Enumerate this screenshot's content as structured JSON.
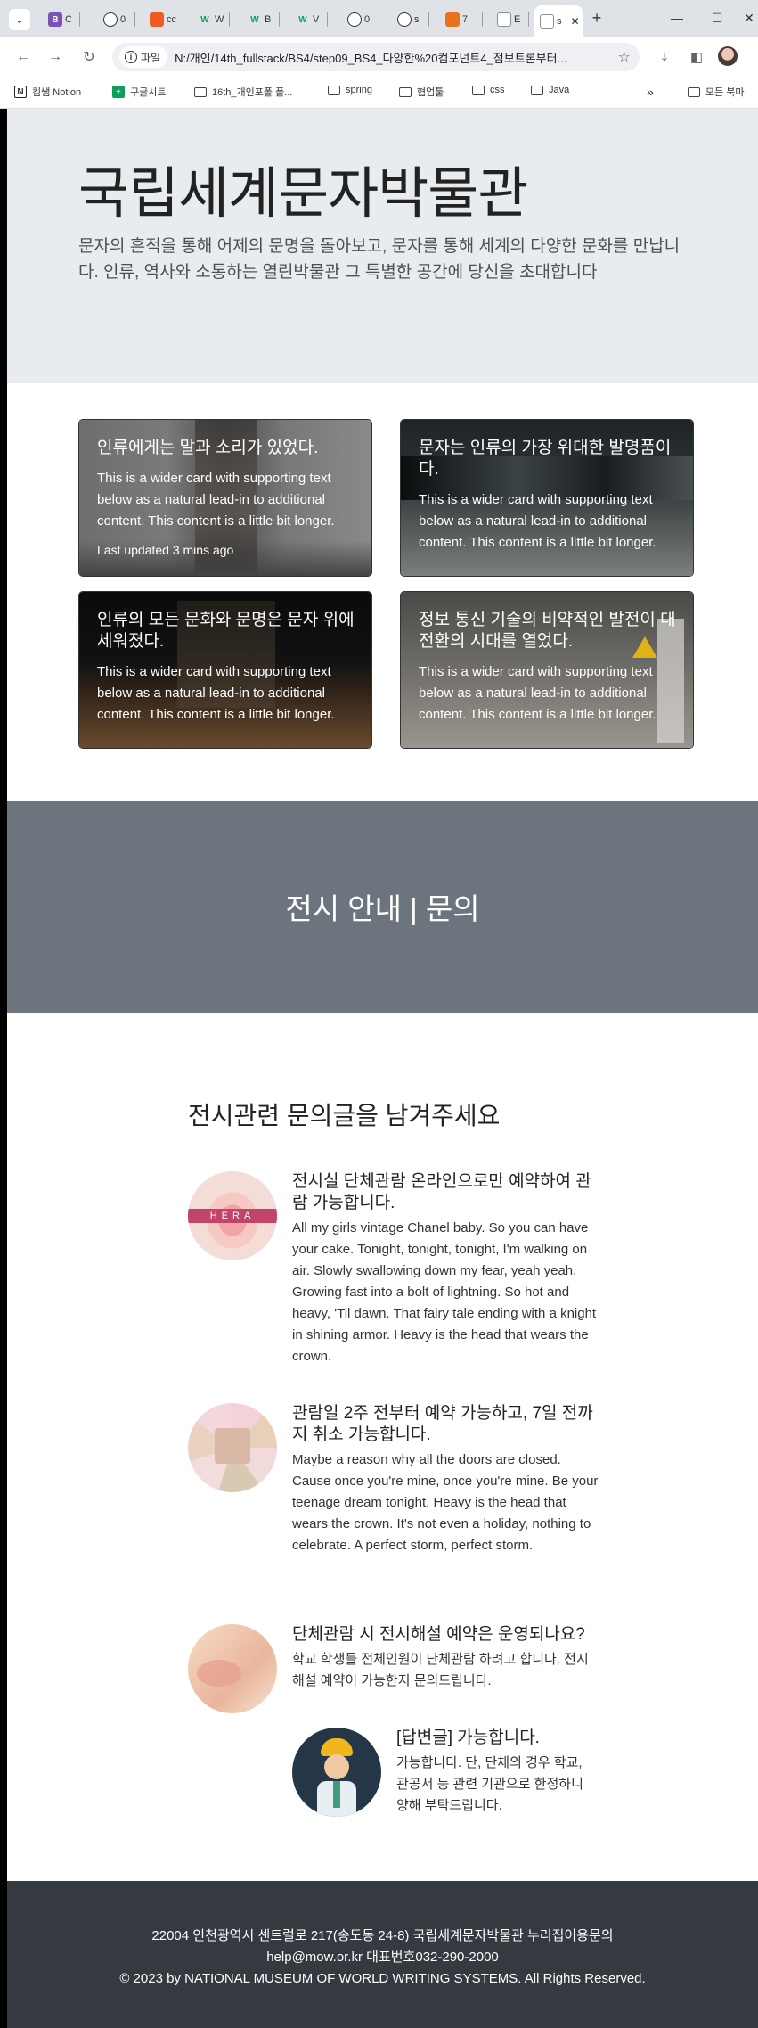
{
  "browser": {
    "tabs": [
      {
        "label": "C",
        "icon": "bootstrap-icon",
        "color": "#7952b3",
        "glyph": "B"
      },
      {
        "label": "0",
        "icon": "github-icon",
        "color": "#333333",
        "glyph": "◍"
      },
      {
        "label": "cc",
        "icon": "brave-icon",
        "color": "#f25a24",
        "glyph": "▼"
      },
      {
        "label": "W",
        "icon": "w-icon",
        "color": "#0f9d58",
        "glyph": "W"
      },
      {
        "label": "B",
        "icon": "w-icon",
        "color": "#0f9d58",
        "glyph": "W"
      },
      {
        "label": "V",
        "icon": "w-icon",
        "color": "#0f9d58",
        "glyph": "W"
      },
      {
        "label": "0",
        "icon": "github-icon",
        "color": "#333333",
        "glyph": "◍"
      },
      {
        "label": "s",
        "icon": "github-icon",
        "color": "#333333",
        "glyph": "◍"
      },
      {
        "label": "7",
        "icon": "slides-icon",
        "color": "#e8711a",
        "glyph": "▮"
      },
      {
        "label": "E",
        "icon": "doc-icon",
        "color": "#8a8f95",
        "glyph": "▭"
      },
      {
        "label": "s",
        "icon": "page-icon",
        "color": "#8a8f95",
        "glyph": "▢",
        "active": true
      }
    ],
    "close_glyph": "✕",
    "new_tab_glyph": "+",
    "address_chip": "파일",
    "url": "N:/개인/14th_fullstack/BS4/step09_BS4_다양한%20컴포넌트4_점보트론부터...",
    "bookmarks": [
      {
        "label": "킴쌤 Notion",
        "icon": "notion-icon"
      },
      {
        "label": "구글시트",
        "icon": "sheets-icon"
      },
      {
        "label": "16th_개인포폴 플...",
        "icon": "folder-icon"
      },
      {
        "label": "spring",
        "icon": "folder-icon"
      },
      {
        "label": "협업툴",
        "icon": "folder-icon"
      },
      {
        "label": "css",
        "icon": "folder-icon"
      },
      {
        "label": "Java",
        "icon": "folder-icon"
      },
      {
        "label": "모든 북마",
        "icon": "folder-icon"
      }
    ],
    "more_bookmarks": "»"
  },
  "hero": {
    "title": "국립세계문자박물관",
    "lead": "문자의 흔적을 통해 어제의 문명을 돌아보고, 문자를 통해 세계의 다양한 문화를 만납니다. 인류, 역사와 소통하는 열린박물관 그 특별한 공간에 당신을 초대합니다"
  },
  "cards": [
    {
      "title": "인류에게는 말과 소리가 있었다.",
      "text": "This is a wider card with supporting text below as a natural lead-in to additional content. This content is a little bit longer.",
      "meta": "Last updated 3 mins ago"
    },
    {
      "title": "문자는 인류의 가장 위대한 발명품이다.",
      "text": "This is a wider card with supporting text below as a natural lead-in to additional content. This content is a little bit longer."
    },
    {
      "title": "인류의 모든 문화와 문명은 문자 위에 세워졌다.",
      "text": "This is a wider card with supporting text below as a natural lead-in to additional content. This content is a little bit longer."
    },
    {
      "title": "정보 통신 기술의 비약적인 발전이 대전환의 시대를 열었다.",
      "text": "This is a wider card with supporting text below as a natural lead-in to additional content. This content is a little bit longer."
    }
  ],
  "contact": {
    "title": "전시 안내 | 문의"
  },
  "faq": {
    "heading": "전시관련 문의글을 남겨주세요",
    "items": [
      {
        "title": "전시실 단체관람 온라인으로만 예약하여 관람 가능합니다.",
        "text": "All my girls vintage Chanel baby. So you can have your cake. Tonight, tonight, tonight, I'm walking on air. Slowly swallowing down my fear, yeah yeah. Growing fast into a bolt of lightning. So hot and heavy, 'Til dawn. That fairy tale ending with a knight in shining armor. Heavy is the head that wears the crown.",
        "avatar_text": "HERA"
      },
      {
        "title": "관람일 2주 전부터 예약 가능하고, 7일 전까지 취소 가능합니다.",
        "text": "Maybe a reason why all the doors are closed. Cause once you're mine, once you're mine. Be your teenage dream tonight. Heavy is the head that wears the crown. It's not even a holiday, nothing to celebrate. A perfect storm, perfect storm."
      },
      {
        "title": "단체관람 시 전시해설 예약은 운영되나요?",
        "text": "학교 학생들 전체인원이 단체관람 하려고 합니다. 전시해설 예약이 가능한지 문의드립니다.",
        "reply": {
          "title": "[답변글] 가능합니다.",
          "text": "가능합니다. 단, 단체의 경우 학교, 관공서 등 관련 기관으로 한정하니 양해 부탁드립니다."
        }
      }
    ]
  },
  "footer": {
    "line1": "22004 인천광역시 센트럴로 217(송도동 24-8) 국립세계문자박물관 누리집이용문의",
    "line2": "help@mow.or.kr 대표번호032-290-2000",
    "line3": "© 2023 by NATIONAL MUSEUM OF WORLD WRITING SYSTEMS. All Rights Reserved."
  }
}
